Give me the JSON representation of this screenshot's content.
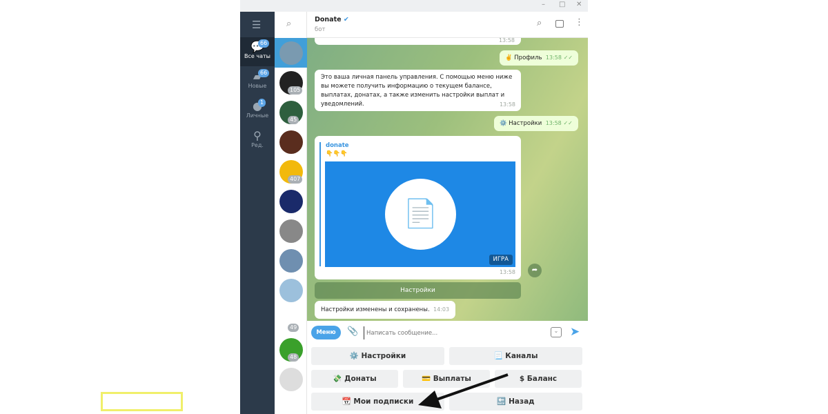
{
  "window": {
    "minimize": "–",
    "maximize": "□",
    "close": "✕"
  },
  "nav": [
    {
      "label": "Все чаты",
      "badge": "66",
      "icon": "chats-icon"
    },
    {
      "label": "Новые",
      "badge": "66",
      "icon": "folder-icon"
    },
    {
      "label": "Личные",
      "badge": "1",
      "icon": "user-icon"
    },
    {
      "label": "Ред.",
      "icon": "edit-filters-icon"
    }
  ],
  "chat_list": [
    {
      "badge": ""
    },
    {
      "badge": "105"
    },
    {
      "badge": "45"
    },
    {
      "badge": ""
    },
    {
      "badge": "407"
    },
    {
      "badge": ""
    },
    {
      "badge": ""
    },
    {
      "badge": ""
    },
    {
      "badge": ""
    },
    {
      "badge": "49"
    },
    {
      "badge": "48"
    },
    {
      "badge": ""
    }
  ],
  "header": {
    "title": "Donate",
    "subtitle": "бот",
    "verified": true
  },
  "messages": [
    {
      "text": "",
      "time": "13:58"
    },
    {
      "text": "✌️ Профиль",
      "time": "13:58"
    },
    {
      "text": "Это ваша личная панель управления. С помощью меню ниже вы можете получить информацию о текущем балансе, выплатах, донатах, а также изменить настройки выплат и уведомлений.",
      "time": "13:58"
    },
    {
      "text": "⚙️ Настройки",
      "time": "13:58"
    },
    {
      "sender": "donate",
      "text": "👇👇👇",
      "badge": "ИГРА",
      "time": "13:58"
    },
    {
      "text": "Настройки изменены и сохранены.",
      "time": "14:03"
    }
  ],
  "inline_button": "Настройки",
  "input": {
    "menu": "Меню",
    "placeholder": "Написать сообщение..."
  },
  "keyboard": [
    [
      "⚙️ Настройки",
      "📃 Каналы"
    ],
    [
      "💸 Донаты",
      "💳 Выплаты",
      "$ Баланс"
    ],
    [
      "📆 Мои подписки",
      "🔙 Назад"
    ]
  ],
  "colors": {
    "accent": "#5ea6e8",
    "highlight": "#f0ef6a",
    "game_bg": "#1e88e5"
  }
}
